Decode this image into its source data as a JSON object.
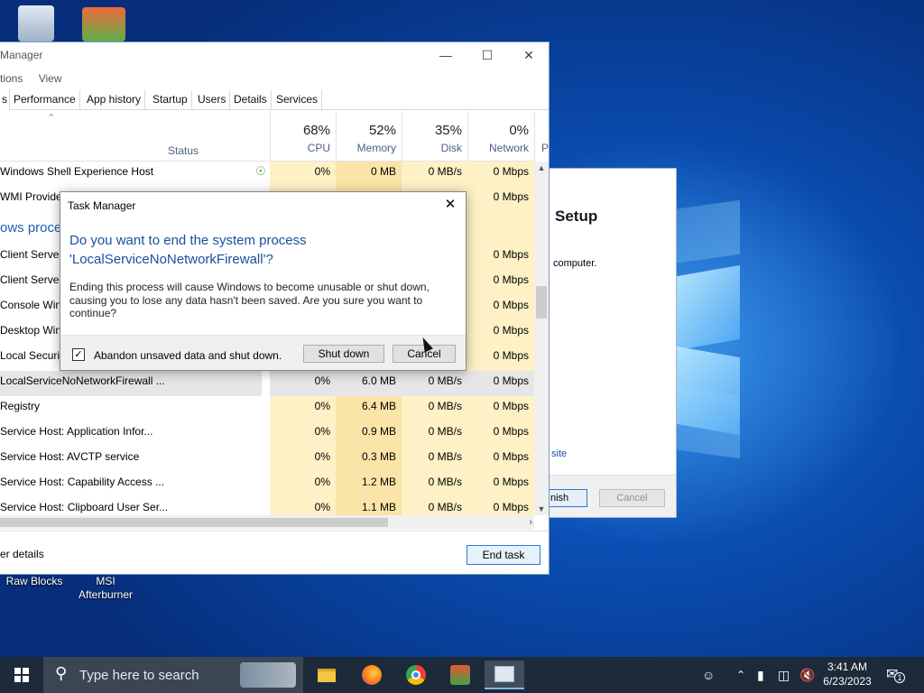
{
  "desktop": {
    "icons": [
      {
        "label": "Raw Blocks"
      },
      {
        "label": "MSI Afterburner"
      }
    ]
  },
  "setup_window": {
    "title": "Setup",
    "text": "computer.",
    "link": "site",
    "finish_label": "nish",
    "cancel_label": "Cancel"
  },
  "task_manager": {
    "title": "Manager",
    "menu": [
      "tions",
      "View"
    ],
    "tabs": [
      "s",
      "Performance",
      "App history",
      "Startup",
      "Users",
      "Details",
      "Services"
    ],
    "columns": {
      "status": "Status",
      "cpu": {
        "pct": "68%",
        "label": "CPU"
      },
      "memory": {
        "pct": "52%",
        "label": "Memory"
      },
      "disk": {
        "pct": "35%",
        "label": "Disk"
      },
      "network": {
        "pct": "0%",
        "label": "Network"
      },
      "power_partial": "P"
    },
    "rows": [
      {
        "name": "Windows Shell Experience Host",
        "cpu": "0%",
        "mem": "0 MB",
        "disk": "0 MB/s",
        "net": "0 Mbps"
      },
      {
        "name": "WMI Provider",
        "cpu": "",
        "mem": "",
        "disk": "",
        "net": "0 Mbps"
      },
      {
        "name": "ows proces",
        "cpu": "",
        "mem": "",
        "disk": "",
        "net": ""
      },
      {
        "name": "Client Server",
        "cpu": "",
        "mem": "",
        "disk": "",
        "net": "0 Mbps"
      },
      {
        "name": "Client Server",
        "cpu": "",
        "mem": "",
        "disk": "",
        "net": "0 Mbps"
      },
      {
        "name": "Console Wind",
        "cpu": "",
        "mem": "",
        "disk": "",
        "net": "0 Mbps"
      },
      {
        "name": "Desktop Wind",
        "cpu": "",
        "mem": "",
        "disk": "",
        "net": "0 Mbps"
      },
      {
        "name": "Local Security",
        "cpu": "",
        "mem": "",
        "disk": "",
        "net": "0 Mbps"
      },
      {
        "name": "LocalServiceNoNetworkFirewall ...",
        "cpu": "0%",
        "mem": "6.0 MB",
        "disk": "0 MB/s",
        "net": "0 Mbps"
      },
      {
        "name": "Registry",
        "cpu": "0%",
        "mem": "6.4 MB",
        "disk": "0 MB/s",
        "net": "0 Mbps"
      },
      {
        "name": "Service Host: Application Infor...",
        "cpu": "0%",
        "mem": "0.9 MB",
        "disk": "0 MB/s",
        "net": "0 Mbps"
      },
      {
        "name": "Service Host: AVCTP service",
        "cpu": "0%",
        "mem": "0.3 MB",
        "disk": "0 MB/s",
        "net": "0 Mbps"
      },
      {
        "name": "Service Host: Capability Access ...",
        "cpu": "0%",
        "mem": "1.2 MB",
        "disk": "0 MB/s",
        "net": "0 Mbps"
      },
      {
        "name": "Service Host: Clipboard User Ser...",
        "cpu": "0%",
        "mem": "1.1 MB",
        "disk": "0 MB/s",
        "net": "0 Mbps"
      }
    ],
    "fewer_details": "er details",
    "end_task": "End task"
  },
  "dialog": {
    "title": "Task Manager",
    "heading_line1": "Do you want to end the system process",
    "heading_line2": "'LocalServiceNoNetworkFirewall'?",
    "body": "Ending this process will cause Windows to become unusable or shut down, causing you to lose any data hasn't been saved. Are you sure you want to continue?",
    "checkbox_label": "Abandon unsaved data and shut down.",
    "checkbox_checked": true,
    "shutdown_label": "Shut down",
    "cancel_label": "Cancel"
  },
  "taskbar": {
    "search_placeholder": "Type here to search",
    "time": "3:41 AM",
    "date": "6/23/2023",
    "notification_count": "1"
  }
}
